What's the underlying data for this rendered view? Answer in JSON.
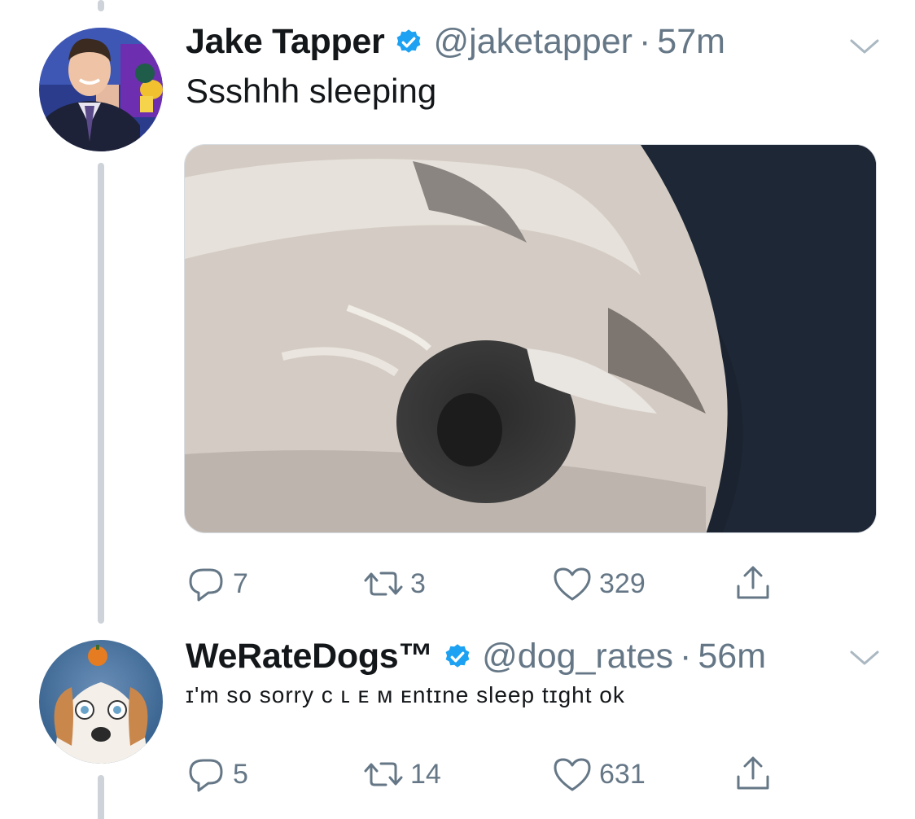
{
  "tweets": [
    {
      "display_name": "Jake Tapper",
      "handle": "@jaketapper",
      "separator": "·",
      "time": "57m",
      "text": "Ssshhh sleeping",
      "reply_count": "7",
      "retweet_count": "3",
      "like_count": "329"
    },
    {
      "display_name": "WeRateDogs™",
      "handle": "@dog_rates",
      "separator": "·",
      "time": "56m",
      "text": "ɪ'm sᴏ sᴏrry ᴄ ʟ ᴇ ᴍ ᴇntɪne sleep tɪght ok",
      "reply_count": "5",
      "retweet_count": "14",
      "like_count": "631"
    }
  ],
  "icons": {
    "verified": "verified-badge-icon",
    "caret": "chevron-down-icon",
    "reply": "reply-icon",
    "retweet": "retweet-icon",
    "like": "heart-icon",
    "share": "share-icon"
  },
  "colors": {
    "verified_blue": "#1da1f2",
    "secondary_text": "#657786",
    "thread_line": "#cdd3d9"
  }
}
